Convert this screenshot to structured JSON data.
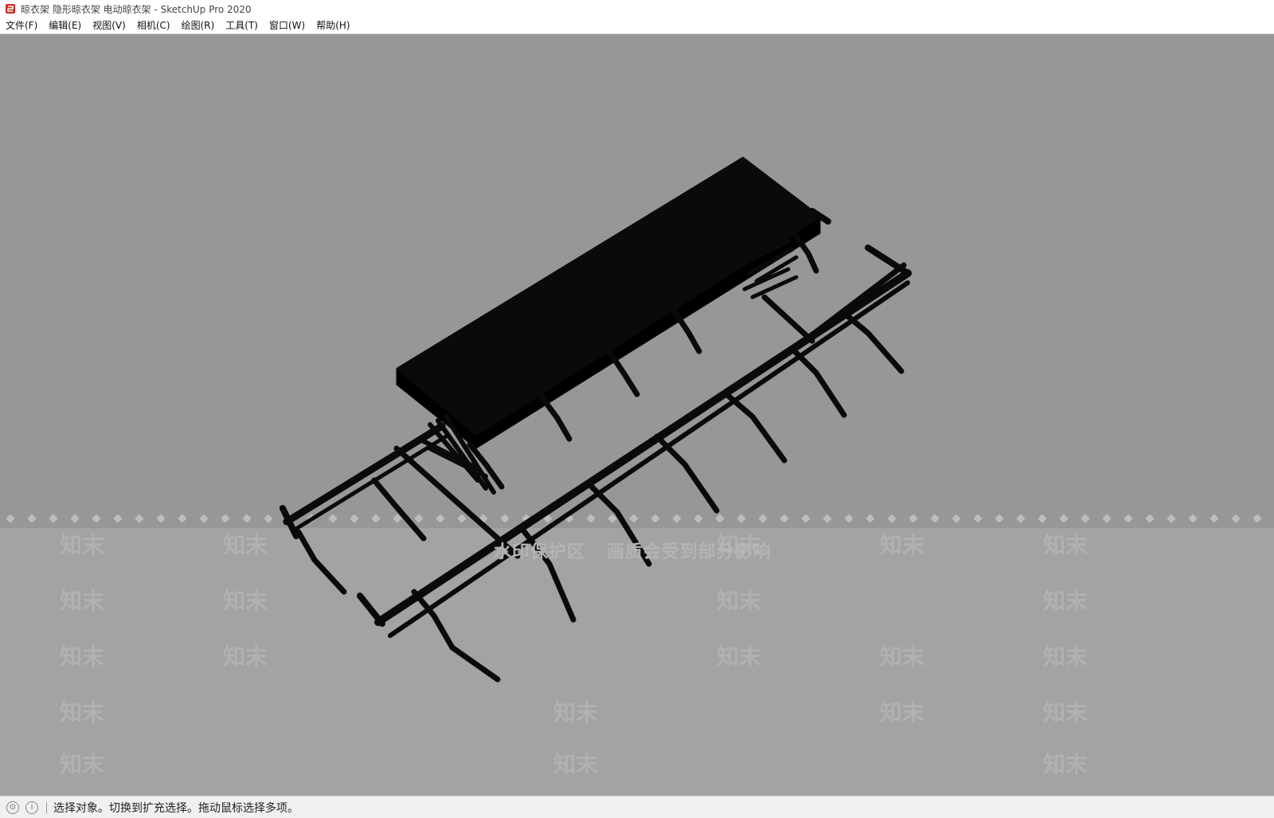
{
  "window": {
    "title": "晾衣架 隐形晾衣架 电动晾衣架 - SketchUp Pro 2020"
  },
  "menu": {
    "items": [
      {
        "label": "文件(F)"
      },
      {
        "label": "编辑(E)"
      },
      {
        "label": "视图(V)"
      },
      {
        "label": "相机(C)"
      },
      {
        "label": "绘图(R)"
      },
      {
        "label": "工具(T)"
      },
      {
        "label": "窗口(W)"
      },
      {
        "label": "帮助(H)"
      }
    ]
  },
  "viewport": {
    "background_color": "#979797",
    "model_color": "#0a0a0a",
    "watermark_notice": [
      "水印保护区",
      "画质会受到部分影响"
    ],
    "watermark_logo": "知末"
  },
  "statusbar": {
    "icons": [
      "geo-location-icon",
      "info-icon"
    ],
    "message": "选择对象。切换到扩充选择。拖动鼠标选择多项。"
  }
}
